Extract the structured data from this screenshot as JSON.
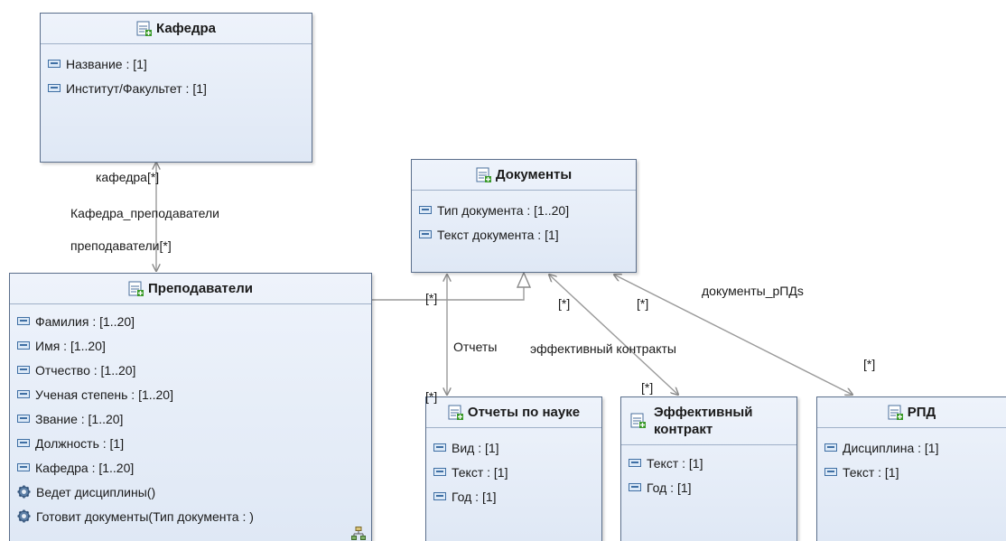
{
  "classes": {
    "kafedra": {
      "name": "Кафедра",
      "attributes": [
        "Название : [1]",
        "Институт/Факультет : [1]"
      ]
    },
    "prepodavateli": {
      "name": "Преподаватели",
      "attributes": [
        "Фамилия : [1..20]",
        "Имя : [1..20]",
        "Отчество : [1..20]",
        "Ученая степень : [1..20]",
        "Звание : [1..20]",
        "Должность : [1]",
        "Кафедра : [1..20]"
      ],
      "operations": [
        "Ведет дисциплины()",
        "Готовит документы(Тип документа : )"
      ]
    },
    "dokumenty": {
      "name": "Документы",
      "attributes": [
        "Тип документа : [1..20]",
        "Текст документа : [1]"
      ]
    },
    "otchety": {
      "name": "Отчеты по науке",
      "attributes": [
        "Вид : [1]",
        "Текст : [1]",
        "Год : [1]"
      ]
    },
    "effektivny": {
      "name_line1": "Эффективный",
      "name_line2": "контракт",
      "attributes": [
        "Текст : [1]",
        "Год : [1]"
      ]
    },
    "rpd": {
      "name": "РПД",
      "attributes": [
        "Дисциплина : [1]",
        "Текст : [1]"
      ]
    }
  },
  "edge_labels": {
    "kafedra_end": "кафедра[*]",
    "assoc_name": "Кафедра_преподаватели",
    "prepod_end": "преподаватели[*]",
    "gen_mult": "[*]",
    "otchety_name": "Отчеты",
    "otchety_mult": "[*]",
    "eff_name": "эффективный контракты",
    "eff_mult_top": "[*]",
    "eff_mult_bottom": "[*]",
    "rpd_mult_top": "[*]",
    "rpd_name": "документы_рПДs",
    "rpd_mult_bottom": "[*]"
  }
}
